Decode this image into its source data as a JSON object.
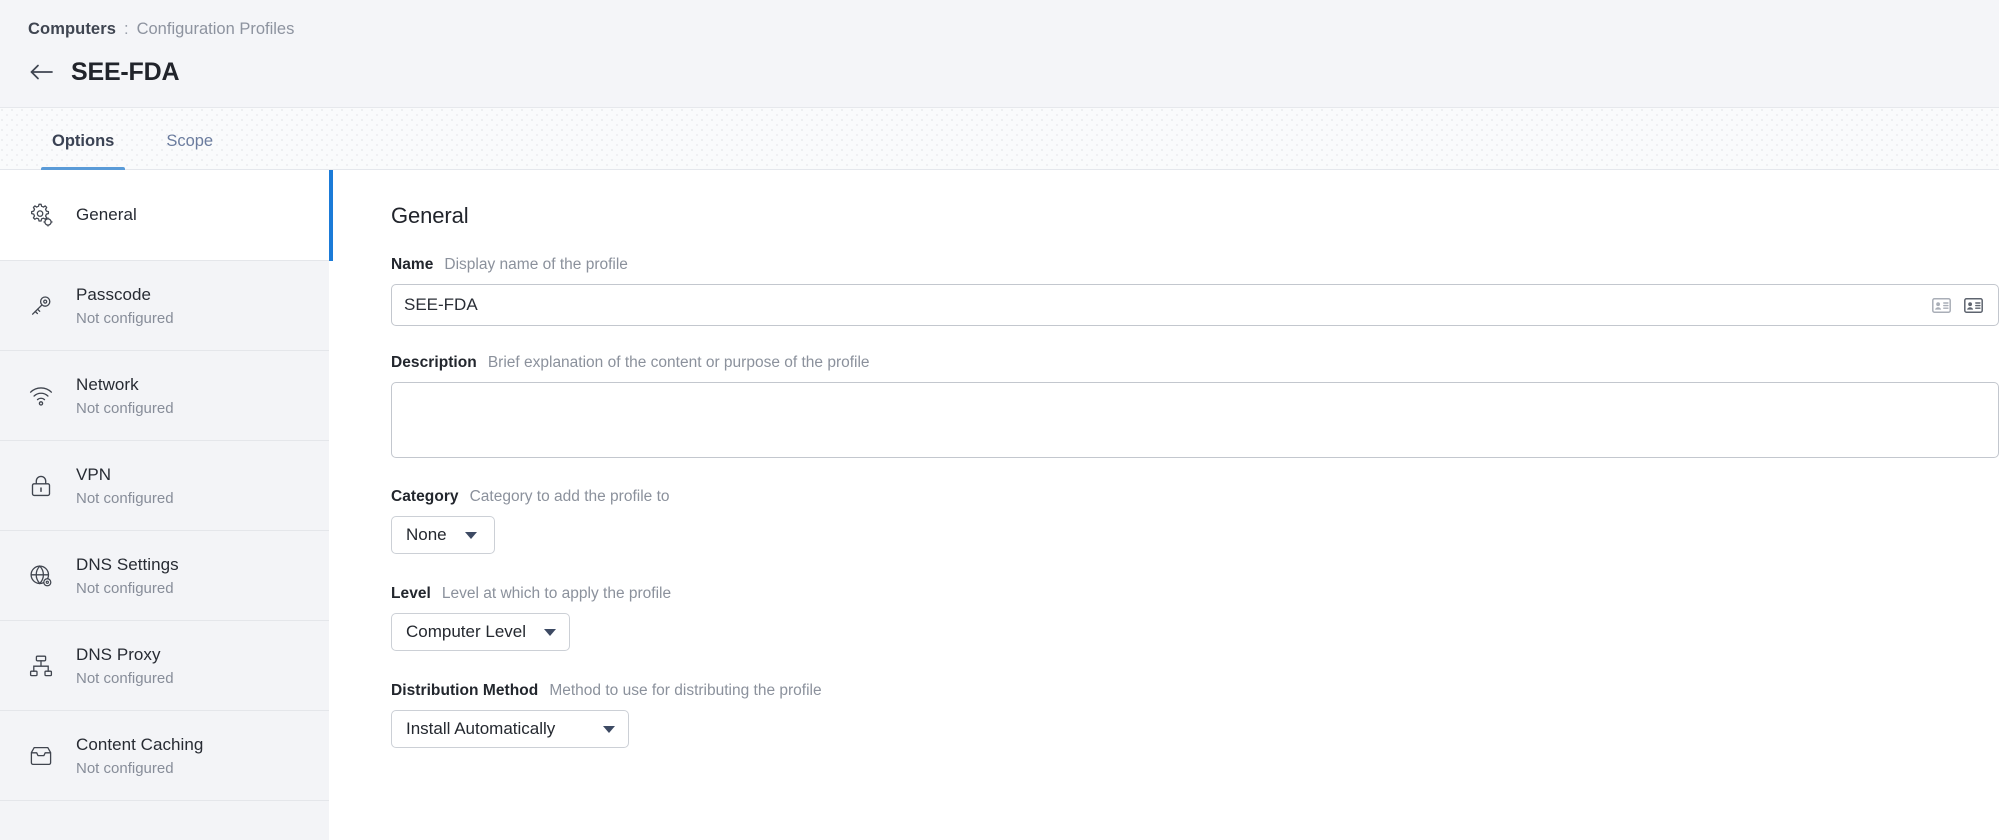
{
  "header": {
    "breadcrumb_root": "Computers",
    "breadcrumb_separator": ":",
    "breadcrumb_current": "Configuration Profiles",
    "back_icon": "arrow-left-icon",
    "title": "SEE-FDA"
  },
  "tabs": [
    {
      "label": "Options",
      "active": true
    },
    {
      "label": "Scope",
      "active": false
    }
  ],
  "sidebar": {
    "items": [
      {
        "label": "General",
        "status": "",
        "icon": "gear-icon",
        "active": true
      },
      {
        "label": "Passcode",
        "status": "Not configured",
        "icon": "key-icon",
        "active": false
      },
      {
        "label": "Network",
        "status": "Not configured",
        "icon": "wifi-icon",
        "active": false
      },
      {
        "label": "VPN",
        "status": "Not configured",
        "icon": "lock-icon",
        "active": false
      },
      {
        "label": "DNS Settings",
        "status": "Not configured",
        "icon": "globe-gear-icon",
        "active": false
      },
      {
        "label": "DNS Proxy",
        "status": "Not configured",
        "icon": "network-tree-icon",
        "active": false
      },
      {
        "label": "Content Caching",
        "status": "Not configured",
        "icon": "inbox-tray-icon",
        "active": false
      }
    ]
  },
  "content": {
    "section_title": "General",
    "name": {
      "label": "Name",
      "help": "Display name of the profile",
      "value": "SEE-FDA",
      "icon_light": "contact-card-icon",
      "icon_dark": "id-card-icon"
    },
    "description": {
      "label": "Description",
      "help": "Brief explanation of the content or purpose of the profile",
      "value": ""
    },
    "category": {
      "label": "Category",
      "help": "Category to add the profile to",
      "value": "None"
    },
    "level": {
      "label": "Level",
      "help": "Level at which to apply the profile",
      "value": "Computer Level"
    },
    "distribution": {
      "label": "Distribution Method",
      "help": "Method to use for distributing the profile",
      "value": "Install Automatically"
    }
  },
  "colors": {
    "accent_blue": "#1b7bd8",
    "tab_underline": "#5a9bd8",
    "header_bg": "#f4f5f8",
    "sidebar_bg": "#f3f4f7"
  }
}
